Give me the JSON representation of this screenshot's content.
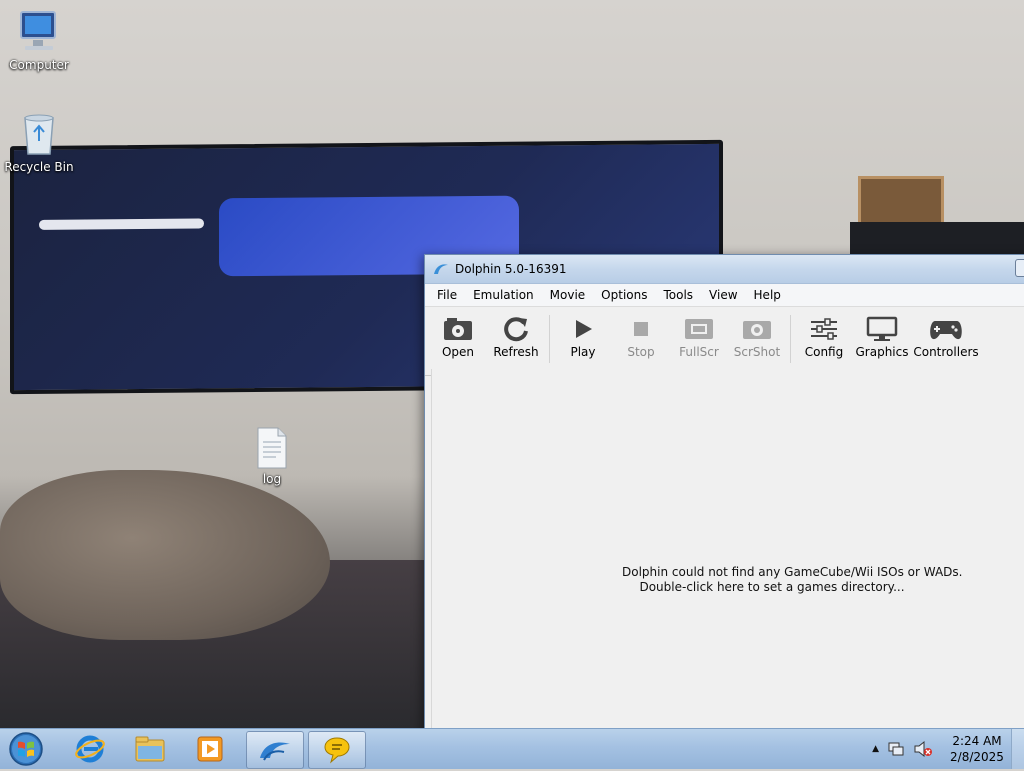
{
  "desktop": {
    "icons": [
      {
        "label": "Computer"
      },
      {
        "label": "Recycle Bin"
      },
      {
        "label": "log"
      }
    ]
  },
  "window": {
    "title": "Dolphin 5.0-16391",
    "menu": [
      "File",
      "Emulation",
      "Movie",
      "Options",
      "Tools",
      "View",
      "Help"
    ],
    "toolbar": [
      {
        "label": "Open",
        "icon": "open-disc-icon",
        "enabled": true
      },
      {
        "label": "Refresh",
        "icon": "refresh-icon",
        "enabled": true
      },
      {
        "label": "Play",
        "icon": "play-icon",
        "enabled": true
      },
      {
        "label": "Stop",
        "icon": "stop-icon",
        "enabled": false
      },
      {
        "label": "FullScr",
        "icon": "fullscreen-icon",
        "enabled": false
      },
      {
        "label": "ScrShot",
        "icon": "screenshot-icon",
        "enabled": false
      },
      {
        "label": "Config",
        "icon": "config-icon",
        "enabled": true
      },
      {
        "label": "Graphics",
        "icon": "monitor-icon",
        "enabled": true
      },
      {
        "label": "Controllers",
        "icon": "gamepad-icon",
        "enabled": true
      }
    ],
    "empty_message": {
      "line1": "Dolphin could not find any GameCube/Wii ISOs or WADs.",
      "line2": "Double-click here to set a games directory..."
    }
  },
  "taskbar": {
    "apps": [
      "start-orb-icon",
      "internet-explorer-icon",
      "file-explorer-icon",
      "media-player-icon",
      "dolphin-icon",
      "chat-bubble-icon"
    ],
    "clock": {
      "time": "2:24 AM",
      "date": "2/8/2025"
    }
  },
  "colors": {
    "taskbar": "#a4c1e2",
    "titlebar": "#c5d7ec",
    "window_bg": "#f0f0f0"
  }
}
